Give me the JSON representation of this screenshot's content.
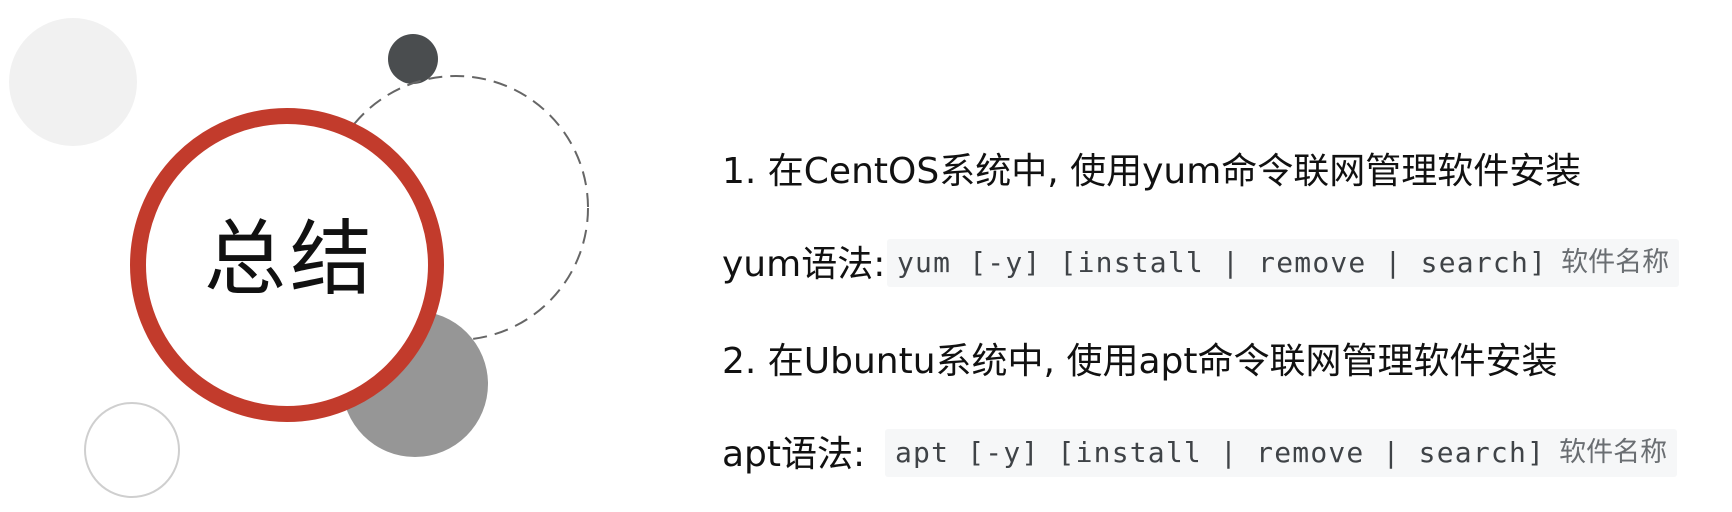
{
  "title": "总结",
  "points": [
    {
      "text": "1. 在CentOS系统中, 使用yum命令联网管理软件安装"
    },
    {
      "label": "yum语法:",
      "code": "yum [-y] [install | remove | search]",
      "suffix": "软件名称"
    },
    {
      "text": "2. 在Ubuntu系统中, 使用apt命令联网管理软件安装"
    },
    {
      "label": "apt语法:",
      "code": "apt [-y] [install | remove | search]",
      "suffix": "软件名称"
    }
  ],
  "colors": {
    "accent_ring": "#c23b2c",
    "dark_circle": "#4a4d4f",
    "gray_circle": "#969696",
    "light_circle": "#f1f1f1",
    "dashed_outline": "#666666",
    "outline_circle": "#cfcfcf",
    "code_background": "#f6f7f8"
  }
}
